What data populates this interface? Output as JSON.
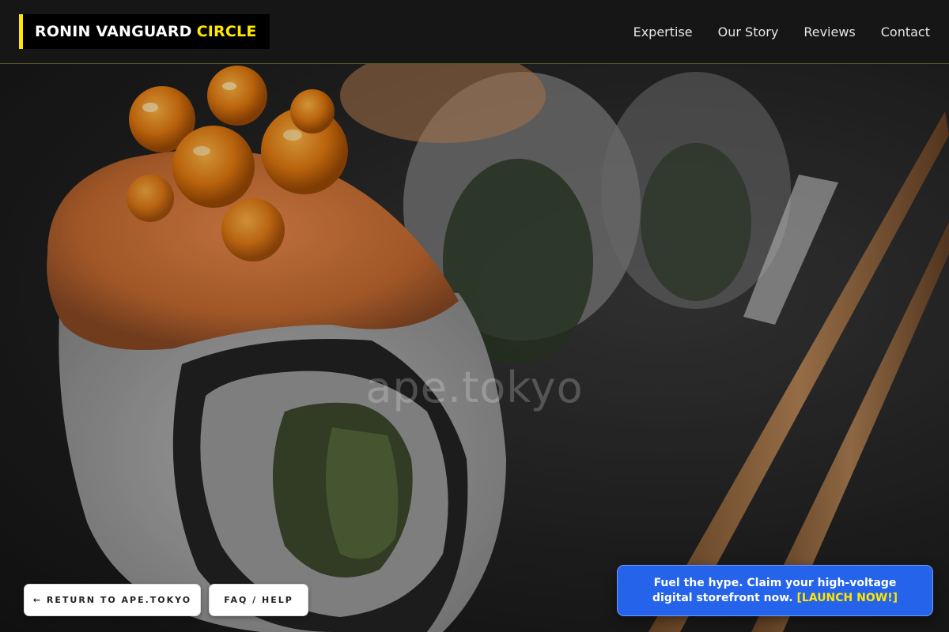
{
  "header": {
    "logo_main": "RONIN VANGUARD",
    "logo_accent": "CIRCLE",
    "nav": [
      {
        "label": "Expertise"
      },
      {
        "label": "Our Story"
      },
      {
        "label": "Reviews"
      },
      {
        "label": "Contact"
      }
    ]
  },
  "hero": {
    "watermark": "ape.tokyo"
  },
  "footer_buttons": {
    "return_label": "← RETURN TO APE.TOKYO",
    "faq_label": "FAQ / HELP"
  },
  "promo": {
    "text": "Fuel the hype. Claim your high-voltage digital storefront now.",
    "cta": "[LAUNCH NOW!]"
  },
  "colors": {
    "accent": "#ffe600",
    "header_bg": "#161616",
    "promo_bg": "#2563eb"
  }
}
